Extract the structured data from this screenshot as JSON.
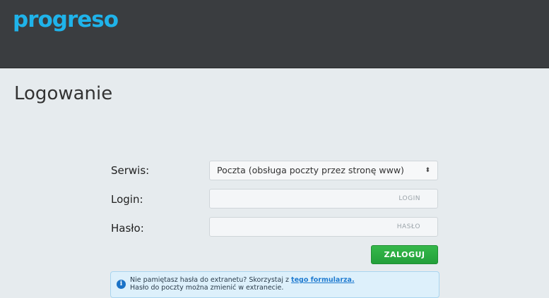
{
  "header": {
    "logo_text": "progreso"
  },
  "main": {
    "title": "Logowanie"
  },
  "form": {
    "service_label": "Serwis:",
    "service_value": "Poczta (obsługa poczty przez stronę www)",
    "login_label": "Login:",
    "login_placeholder": "LOGIN",
    "password_label": "Hasło:",
    "password_placeholder": "HASŁO",
    "submit_label": "ZALOGUJ"
  },
  "info": {
    "line1_prefix": "Nie pamiętasz hasła do extranetu? Skorzystaj z",
    "link_text": "tego formularza.",
    "line2": "Hasło do poczty można zmienić w extranecie."
  },
  "colors": {
    "accent": "#1fb3ea",
    "header_bg": "#3a3d40",
    "button": "#2aa940"
  }
}
